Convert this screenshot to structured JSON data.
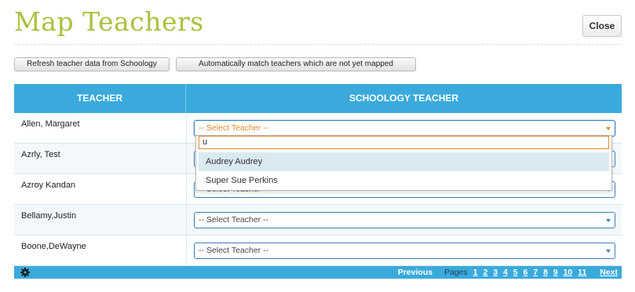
{
  "page": {
    "title": "Map Teachers",
    "close_label": "Close"
  },
  "toolbar": {
    "refresh_label": "Refresh teacher data from Schoology",
    "auto_match_label": "Automatically match teachers which are not yet mapped"
  },
  "table": {
    "headers": {
      "teacher": "TEACHER",
      "schoology_teacher": "SCHOOLOGY TEACHER"
    },
    "rows": [
      {
        "teacher": "Allen, Margaret",
        "selection": "-- Select Teacher --"
      },
      {
        "teacher": "Azrly, Test",
        "selection": ""
      },
      {
        "teacher": "Azroy Kandan",
        "selection": "-- Select Teacher --"
      },
      {
        "teacher": "Bellamy,Justin",
        "selection": "-- Select Teacher --"
      },
      {
        "teacher": "Boone,DeWayne",
        "selection": "-- Select Teacher --"
      }
    ]
  },
  "dropdown": {
    "search_value": "u",
    "options": [
      "Audrey Audrey",
      "Super Sue Perkins"
    ],
    "highlighted_index": 0
  },
  "pager": {
    "previous": "Previous",
    "pages_label": "Pages",
    "pages": [
      "1",
      "2",
      "3",
      "4",
      "5",
      "6",
      "7",
      "8",
      "9",
      "10",
      "11"
    ],
    "next": "Next"
  },
  "icons": {
    "footer_settings": "gear-icon"
  },
  "colors": {
    "title": "#a7c23e",
    "header_bg": "#3aaadc",
    "select_open_accent": "#e58a2e"
  }
}
